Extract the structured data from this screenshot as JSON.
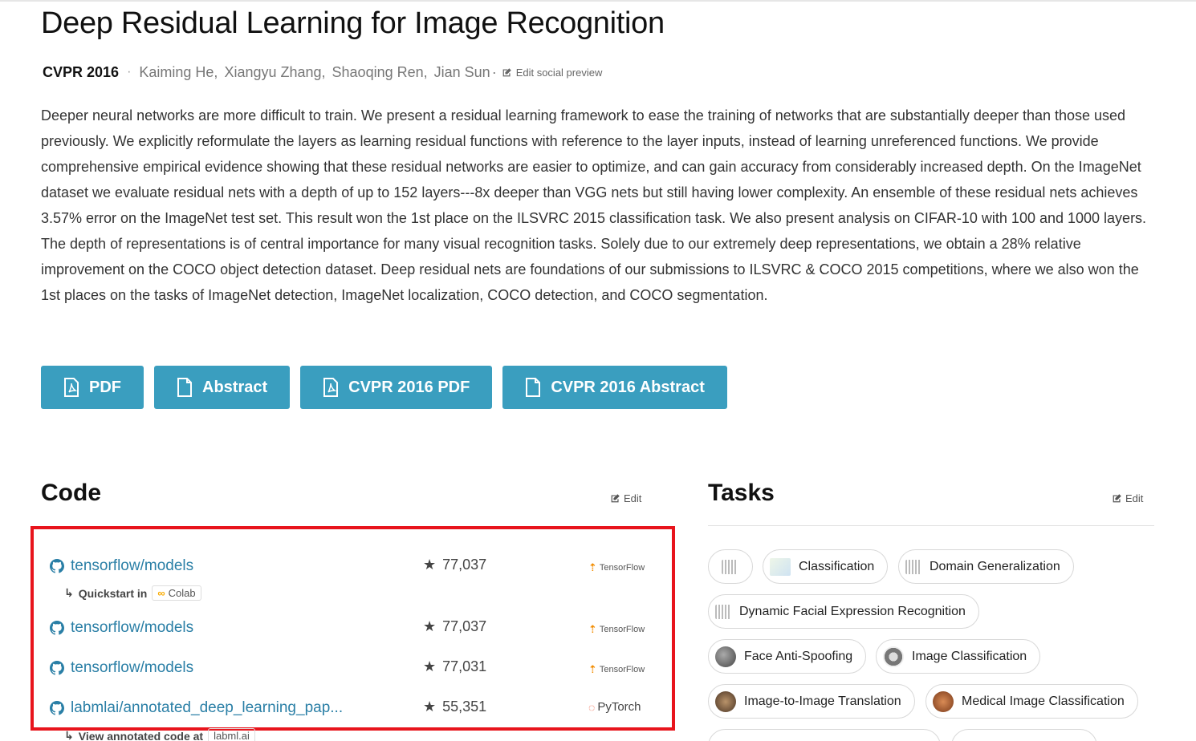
{
  "paper": {
    "title": "Deep Residual Learning for Image Recognition",
    "conference": "CVPR 2016",
    "authors": [
      "Kaiming He,",
      "Xiangyu Zhang,",
      "Shaoqing Ren,",
      "Jian Sun"
    ],
    "edit_social_label": "Edit social preview",
    "abstract": "Deeper neural networks are more difficult to train. We present a residual learning framework to ease the training of networks that are substantially deeper than those used previously. We explicitly reformulate the layers as learning residual functions with reference to the layer inputs, instead of learning unreferenced functions. We provide comprehensive empirical evidence showing that these residual networks are easier to optimize, and can gain accuracy from considerably increased depth. On the ImageNet dataset we evaluate residual nets with a depth of up to 152 layers---8x deeper than VGG nets but still having lower complexity. An ensemble of these residual nets achieves 3.57% error on the ImageNet test set. This result won the 1st place on the ILSVRC 2015 classification task. We also present analysis on CIFAR-10 with 100 and 1000 layers. The depth of representations is of central importance for many visual recognition tasks. Solely due to our extremely deep representations, we obtain a 28% relative improvement on the COCO object detection dataset. Deep residual nets are foundations of our submissions to ILSVRC & COCO 2015 competitions, where we also won the 1st places on the tasks of ImageNet detection, ImageNet localization, COCO detection, and COCO segmentation."
  },
  "buttons": [
    {
      "label": "PDF",
      "icon": "pdf-icon"
    },
    {
      "label": "Abstract",
      "icon": "document-icon"
    },
    {
      "label": "CVPR 2016 PDF",
      "icon": "pdf-icon"
    },
    {
      "label": "CVPR 2016 Abstract",
      "icon": "document-icon"
    }
  ],
  "code": {
    "heading": "Code",
    "edit_label": "Edit",
    "repos": [
      {
        "name": "tensorflow/models",
        "stars": "77,037",
        "framework": "TensorFlow",
        "sub_label": "Quickstart in",
        "sub_badge": "Colab"
      },
      {
        "name": "tensorflow/models",
        "stars": "77,037",
        "framework": "TensorFlow"
      },
      {
        "name": "tensorflow/models",
        "stars": "77,031",
        "framework": "TensorFlow"
      },
      {
        "name": "labmlai/annotated_deep_learning_pap...",
        "stars": "55,351",
        "framework": "PyTorch",
        "sub_label": "View annotated code at",
        "sub_badge": "labml.ai"
      }
    ]
  },
  "tasks": {
    "heading": "Tasks",
    "edit_label": "Edit",
    "items": [
      {
        "label": "",
        "icon": "barcode-icon"
      },
      {
        "label": "Classification",
        "icon": "chart-icon"
      },
      {
        "label": "Domain Generalization",
        "icon": "barcode-icon"
      },
      {
        "label": "Dynamic Facial Expression Recognition",
        "icon": "barcode-icon"
      },
      {
        "label": "Face Anti-Spoofing",
        "icon": "face-icon"
      },
      {
        "label": "Image Classification",
        "icon": "image-icon"
      },
      {
        "label": "Image-to-Image Translation",
        "icon": "crowd-icon"
      },
      {
        "label": "Medical Image Classification",
        "icon": "medical-icon"
      }
    ]
  },
  "colors": {
    "button_bg": "#3a9ebf",
    "link": "#2a7fa6",
    "highlight_border": "#e8141c",
    "tensorflow": "#f28c00",
    "pytorch": "#ee4c2c"
  }
}
